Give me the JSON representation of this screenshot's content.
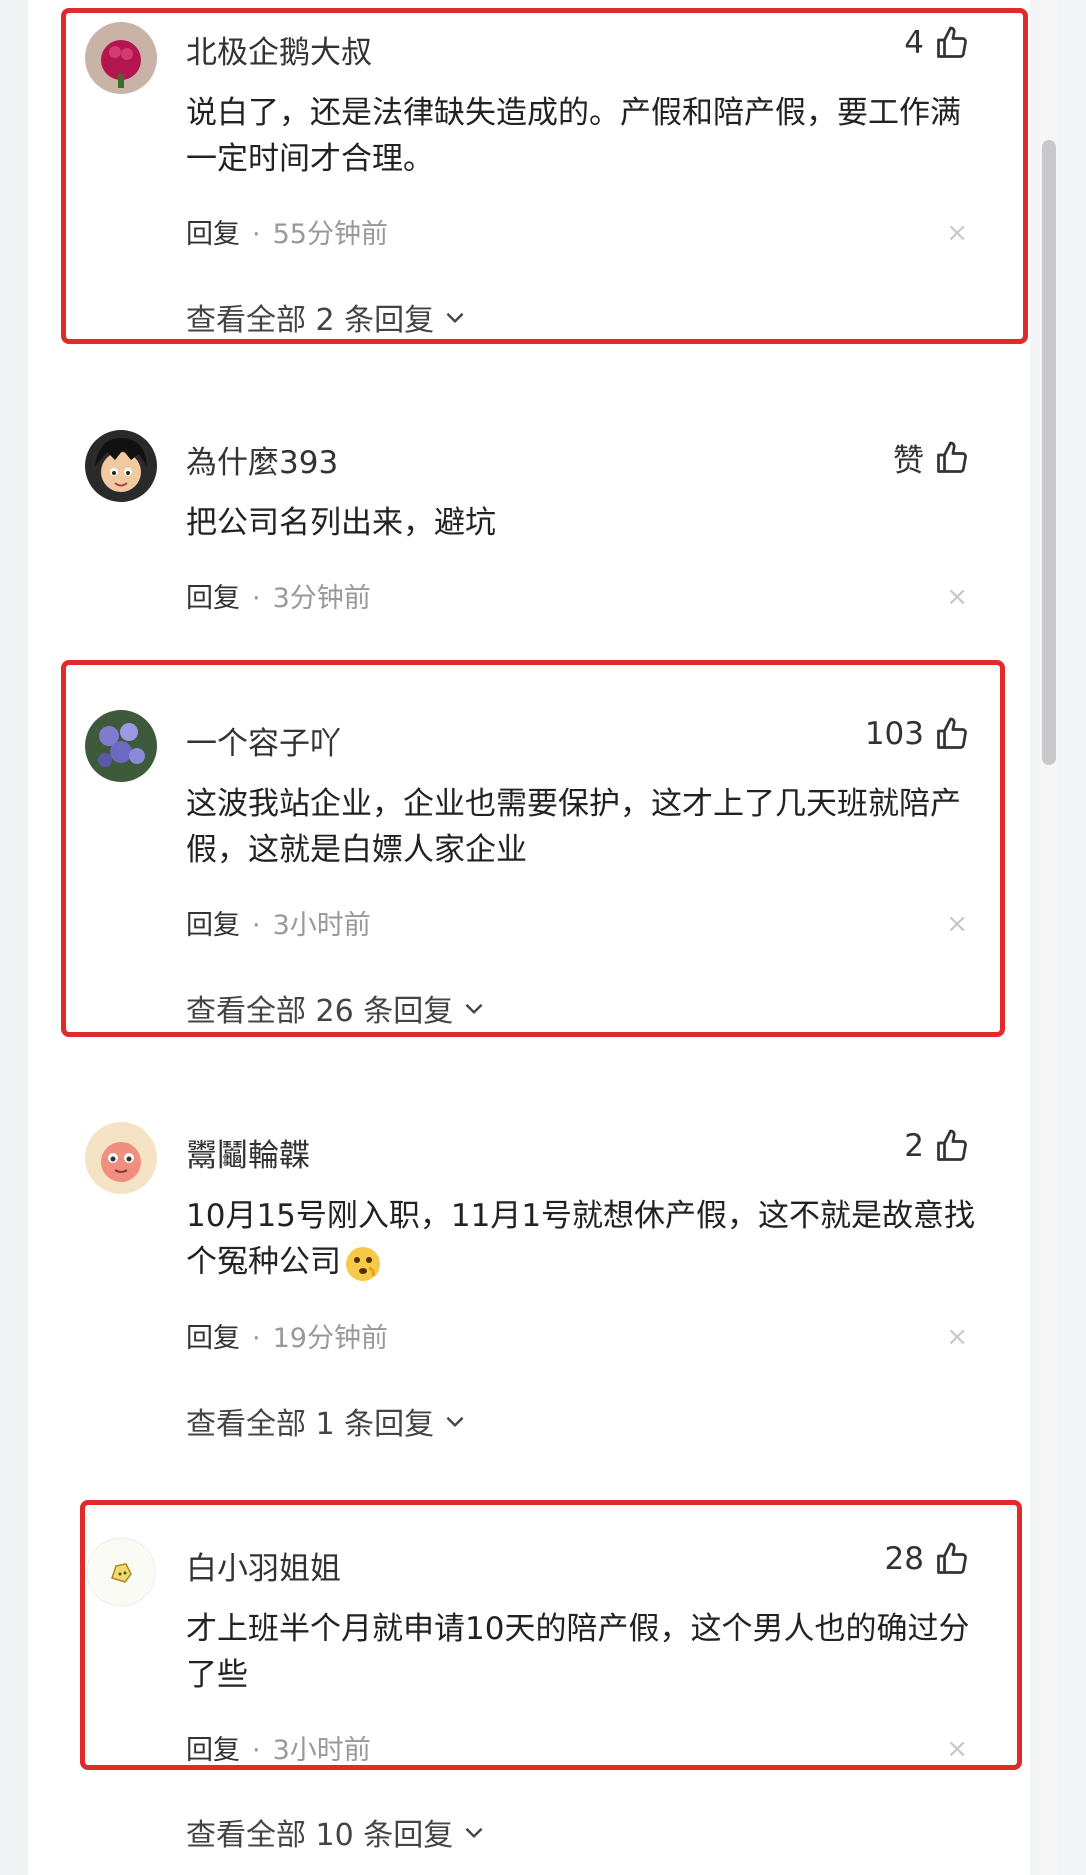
{
  "comments": [
    {
      "username": "北极企鹅大叔",
      "likes": "4",
      "text": "说白了，还是法律缺失造成的。产假和陪产假，要工作满一定时间才合理。",
      "reply_label": "回复",
      "separator": "·",
      "time": "55分钟前",
      "view_all": "查看全部 2 条回复"
    },
    {
      "username": "為什麼393",
      "likes": "赞",
      "text": "把公司名列出来，避坑",
      "reply_label": "回复",
      "separator": "·",
      "time": "3分钟前",
      "view_all": ""
    },
    {
      "username": "一个容子吖",
      "likes": "103",
      "text": "这波我站企业，企业也需要保护，这才上了几天班就陪产假，这就是白嫖人家企业",
      "reply_label": "回复",
      "separator": "·",
      "time": "3小时前",
      "view_all": "查看全部 26 条回复"
    },
    {
      "username": "鬻鬮輪韘",
      "likes": "2",
      "text": "10月15号刚入职，11月1号就想休产假，这不就是故意找个冤种公司",
      "reply_label": "回复",
      "separator": "·",
      "time": "19分钟前",
      "view_all": "查看全部 1 条回复"
    },
    {
      "username": "白小羽姐姐",
      "likes": "28",
      "text": "才上班半个月就申请10天的陪产假，这个男人也的确过分了些",
      "reply_label": "回复",
      "separator": "·",
      "time": "3小时前",
      "view_all": "查看全部 10 条回复"
    }
  ],
  "close_glyph": "×",
  "colors": {
    "highlight": "#e02b2b",
    "secondary_text": "#999999",
    "primary_text": "#222222"
  },
  "icons": {
    "like": "thumbs-up-icon",
    "expand": "chevron-down-icon",
    "close": "close-icon"
  }
}
